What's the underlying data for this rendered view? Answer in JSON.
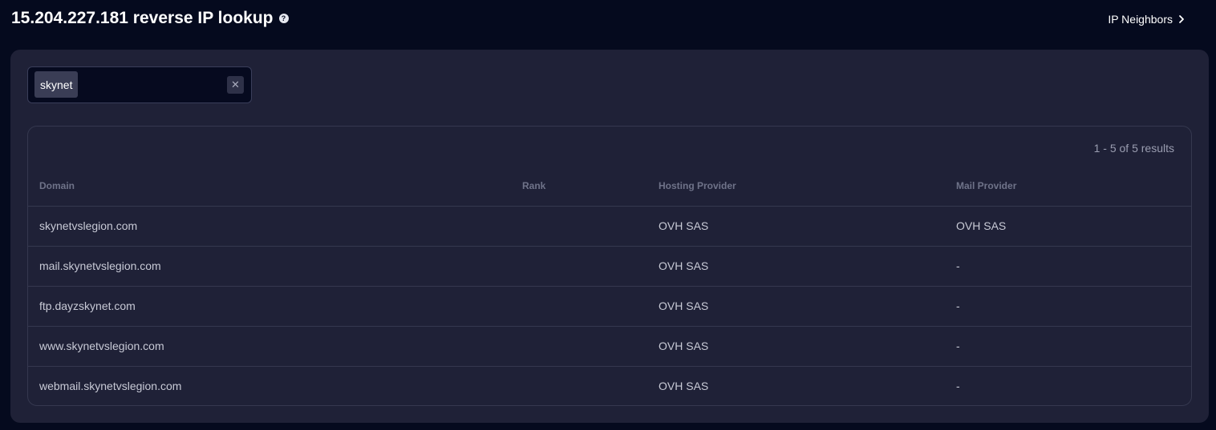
{
  "header": {
    "title": "15.204.227.181 reverse IP lookup",
    "help_icon": "question-circle-icon",
    "nav_link_label": "IP Neighbors",
    "nav_link_icon": "chevron-right-icon"
  },
  "filter": {
    "tag": "skynet",
    "clear_icon": "close-icon"
  },
  "results": {
    "count_text": "1 - 5 of 5 results",
    "columns": [
      "Domain",
      "Rank",
      "Hosting Provider",
      "Mail Provider"
    ],
    "rows": [
      {
        "domain": "skynetvslegion.com",
        "rank": "",
        "hosting": "OVH SAS",
        "mail": "OVH SAS"
      },
      {
        "domain": "mail.skynetvslegion.com",
        "rank": "",
        "hosting": "OVH SAS",
        "mail": "-"
      },
      {
        "domain": "ftp.dayzskynet.com",
        "rank": "",
        "hosting": "OVH SAS",
        "mail": "-"
      },
      {
        "domain": "www.skynetvslegion.com",
        "rank": "",
        "hosting": "OVH SAS",
        "mail": "-"
      },
      {
        "domain": "webmail.skynetvslegion.com",
        "rank": "",
        "hosting": "OVH SAS",
        "mail": "-"
      }
    ]
  },
  "colors": {
    "page_background": "#050a1e",
    "panel_background": "#1f2137",
    "link": "#9ca6f2",
    "muted_text": "#6f7389"
  }
}
